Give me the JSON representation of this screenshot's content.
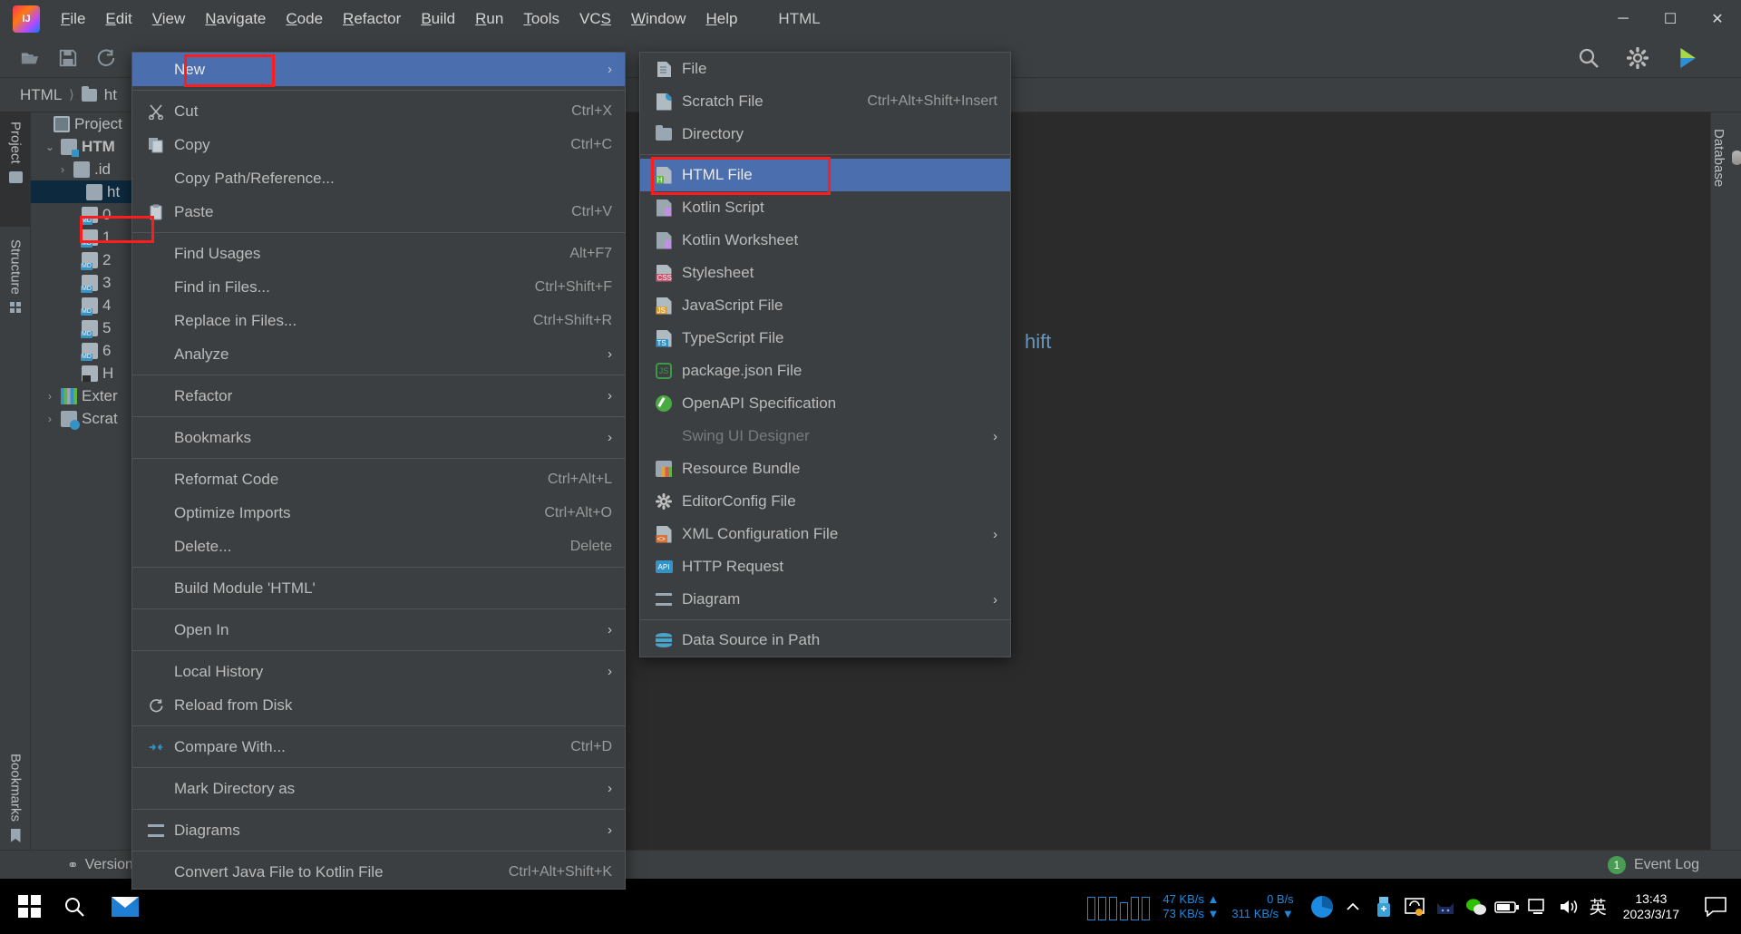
{
  "window": {
    "title": "HTML",
    "controls": {
      "minimize": "─",
      "maximize": "☐",
      "close": "✕"
    }
  },
  "menubar": {
    "items": [
      {
        "label": "File"
      },
      {
        "label": "Edit"
      },
      {
        "label": "View"
      },
      {
        "label": "Navigate"
      },
      {
        "label": "Code"
      },
      {
        "label": "Refactor"
      },
      {
        "label": "Build"
      },
      {
        "label": "Run"
      },
      {
        "label": "Tools"
      },
      {
        "label": "VCS"
      },
      {
        "label": "Window"
      },
      {
        "label": "Help"
      }
    ]
  },
  "breadcrumbs": {
    "project": "HTML",
    "path": "ht"
  },
  "rails": {
    "left": [
      {
        "label": "Project",
        "icon": "project-icon"
      },
      {
        "label": "Structure",
        "icon": "structure-icon"
      },
      {
        "label": "Bookmarks",
        "icon": "bookmark-icon"
      }
    ],
    "right": [
      {
        "label": "Database",
        "icon": "database-icon"
      }
    ]
  },
  "project_tree": [
    {
      "label": "Project",
      "icon": "project-icon",
      "arrow": "",
      "indent": 0,
      "selected": false
    },
    {
      "label": "HTM",
      "icon": "module-icon",
      "arrow": "⌄",
      "indent": 1,
      "selected": false
    },
    {
      "label": ".id",
      "icon": "folder-icon",
      "arrow": "›",
      "indent": 2,
      "selected": false
    },
    {
      "label": "ht",
      "icon": "folder-icon",
      "arrow": "",
      "indent": 3,
      "selected": true
    },
    {
      "label": "0",
      "icon": "markdown-icon",
      "arrow": "",
      "indent": 4,
      "selected": false
    },
    {
      "label": "1",
      "icon": "markdown-icon",
      "arrow": "",
      "indent": 4,
      "selected": false
    },
    {
      "label": "2",
      "icon": "markdown-icon",
      "arrow": "",
      "indent": 4,
      "selected": false
    },
    {
      "label": "3",
      "icon": "markdown-icon",
      "arrow": "",
      "indent": 4,
      "selected": false
    },
    {
      "label": "4",
      "icon": "markdown-icon",
      "arrow": "",
      "indent": 4,
      "selected": false
    },
    {
      "label": "5",
      "icon": "markdown-icon",
      "arrow": "",
      "indent": 4,
      "selected": false
    },
    {
      "label": "6",
      "icon": "markdown-icon",
      "arrow": "",
      "indent": 4,
      "selected": false
    },
    {
      "label": "H",
      "icon": "html-file-icon",
      "arrow": "",
      "indent": 4,
      "selected": false
    },
    {
      "label": "Exter",
      "icon": "library-icon",
      "arrow": "›",
      "indent": 1,
      "selected": false
    },
    {
      "label": "Scrat",
      "icon": "scratch-icon",
      "arrow": "›",
      "indent": 1,
      "selected": false
    }
  ],
  "editor": {
    "visible_text": "hift"
  },
  "context_menu": {
    "items": [
      {
        "label": "New",
        "key": "",
        "arrow": "›",
        "icon": "",
        "highlight": true,
        "sep_after": true
      },
      {
        "label": "Cut",
        "key": "Ctrl+X",
        "arrow": "",
        "icon": "scissors-icon"
      },
      {
        "label": "Copy",
        "key": "Ctrl+C",
        "arrow": "",
        "icon": "copy-icon"
      },
      {
        "label": "Copy Path/Reference...",
        "key": "",
        "arrow": "",
        "icon": ""
      },
      {
        "label": "Paste",
        "key": "Ctrl+V",
        "arrow": "",
        "icon": "paste-icon",
        "sep_after": true
      },
      {
        "label": "Find Usages",
        "key": "Alt+F7",
        "arrow": "",
        "icon": ""
      },
      {
        "label": "Find in Files...",
        "key": "Ctrl+Shift+F",
        "arrow": "",
        "icon": ""
      },
      {
        "label": "Replace in Files...",
        "key": "Ctrl+Shift+R",
        "arrow": "",
        "icon": ""
      },
      {
        "label": "Analyze",
        "key": "",
        "arrow": "›",
        "icon": "",
        "sep_after": true
      },
      {
        "label": "Refactor",
        "key": "",
        "arrow": "›",
        "icon": "",
        "sep_after": true
      },
      {
        "label": "Bookmarks",
        "key": "",
        "arrow": "›",
        "icon": "",
        "sep_after": true
      },
      {
        "label": "Reformat Code",
        "key": "Ctrl+Alt+L",
        "arrow": "",
        "icon": ""
      },
      {
        "label": "Optimize Imports",
        "key": "Ctrl+Alt+O",
        "arrow": "",
        "icon": ""
      },
      {
        "label": "Delete...",
        "key": "Delete",
        "arrow": "",
        "icon": "",
        "sep_after": true
      },
      {
        "label": "Build Module 'HTML'",
        "key": "",
        "arrow": "",
        "icon": "",
        "sep_after": true
      },
      {
        "label": "Open In",
        "key": "",
        "arrow": "›",
        "icon": "",
        "sep_after": true
      },
      {
        "label": "Local History",
        "key": "",
        "arrow": "›",
        "icon": ""
      },
      {
        "label": "Reload from Disk",
        "key": "",
        "arrow": "",
        "icon": "reload-icon",
        "sep_after": true
      },
      {
        "label": "Compare With...",
        "key": "Ctrl+D",
        "arrow": "",
        "icon": "compare-icon",
        "sep_after": true
      },
      {
        "label": "Mark Directory as",
        "key": "",
        "arrow": "›",
        "icon": "",
        "sep_after": true
      },
      {
        "label": "Diagrams",
        "key": "",
        "arrow": "›",
        "icon": "diagram-icon",
        "sep_after": true
      },
      {
        "label": "Convert Java File to Kotlin File",
        "key": "Ctrl+Alt+Shift+K",
        "arrow": "",
        "icon": ""
      }
    ]
  },
  "submenu": {
    "items": [
      {
        "label": "File",
        "key": "",
        "arrow": "",
        "icon": "file-icon"
      },
      {
        "label": "Scratch File",
        "key": "Ctrl+Alt+Shift+Insert",
        "arrow": "",
        "icon": "scratch-file-icon"
      },
      {
        "label": "Directory",
        "key": "",
        "arrow": "",
        "icon": "directory-icon",
        "sep_after": true
      },
      {
        "label": "HTML File",
        "key": "",
        "arrow": "",
        "icon": "html-file-icon",
        "highlight": true
      },
      {
        "label": "Kotlin Script",
        "key": "",
        "arrow": "",
        "icon": "kotlin-icon"
      },
      {
        "label": "Kotlin Worksheet",
        "key": "",
        "arrow": "",
        "icon": "kotlin-icon"
      },
      {
        "label": "Stylesheet",
        "key": "",
        "arrow": "",
        "icon": "css-file-icon"
      },
      {
        "label": "JavaScript File",
        "key": "",
        "arrow": "",
        "icon": "js-file-icon"
      },
      {
        "label": "TypeScript File",
        "key": "",
        "arrow": "",
        "icon": "ts-file-icon"
      },
      {
        "label": "package.json File",
        "key": "",
        "arrow": "",
        "icon": "nodejs-icon"
      },
      {
        "label": "OpenAPI Specification",
        "key": "",
        "arrow": "",
        "icon": "openapi-icon"
      },
      {
        "label": "Swing UI Designer",
        "key": "",
        "arrow": "›",
        "icon": "",
        "disabled": true
      },
      {
        "label": "Resource Bundle",
        "key": "",
        "arrow": "",
        "icon": "resource-bundle-icon"
      },
      {
        "label": "EditorConfig File",
        "key": "",
        "arrow": "",
        "icon": "gear-icon"
      },
      {
        "label": "XML Configuration File",
        "key": "",
        "arrow": "›",
        "icon": "xml-file-icon"
      },
      {
        "label": "HTTP Request",
        "key": "",
        "arrow": "",
        "icon": "http-icon"
      },
      {
        "label": "Diagram",
        "key": "",
        "arrow": "›",
        "icon": "diagram-icon",
        "sep_after": true
      },
      {
        "label": "Data Source in Path",
        "key": "",
        "arrow": "",
        "icon": "datasource-icon"
      }
    ]
  },
  "statusbar": {
    "version_control": "Version C",
    "event_log": "Event Log",
    "event_count": "1"
  },
  "taskbar": {
    "network": {
      "up_speed": "47 KB/s",
      "down_speed": "73 KB/s",
      "up_arrow": "▲",
      "down_arrow": "▼",
      "second_up": "0 B/s",
      "second_down": "311 KB/s"
    },
    "ime": "英",
    "time": "13:43",
    "date": "2023/3/17"
  },
  "colors": {
    "accent": "#4b6eaf",
    "annotation": "#ff1c1c",
    "panel_bg": "#3c3f41",
    "editor_bg": "#2b2b2b",
    "selection": "#0d293e",
    "link": "#6897bb"
  }
}
